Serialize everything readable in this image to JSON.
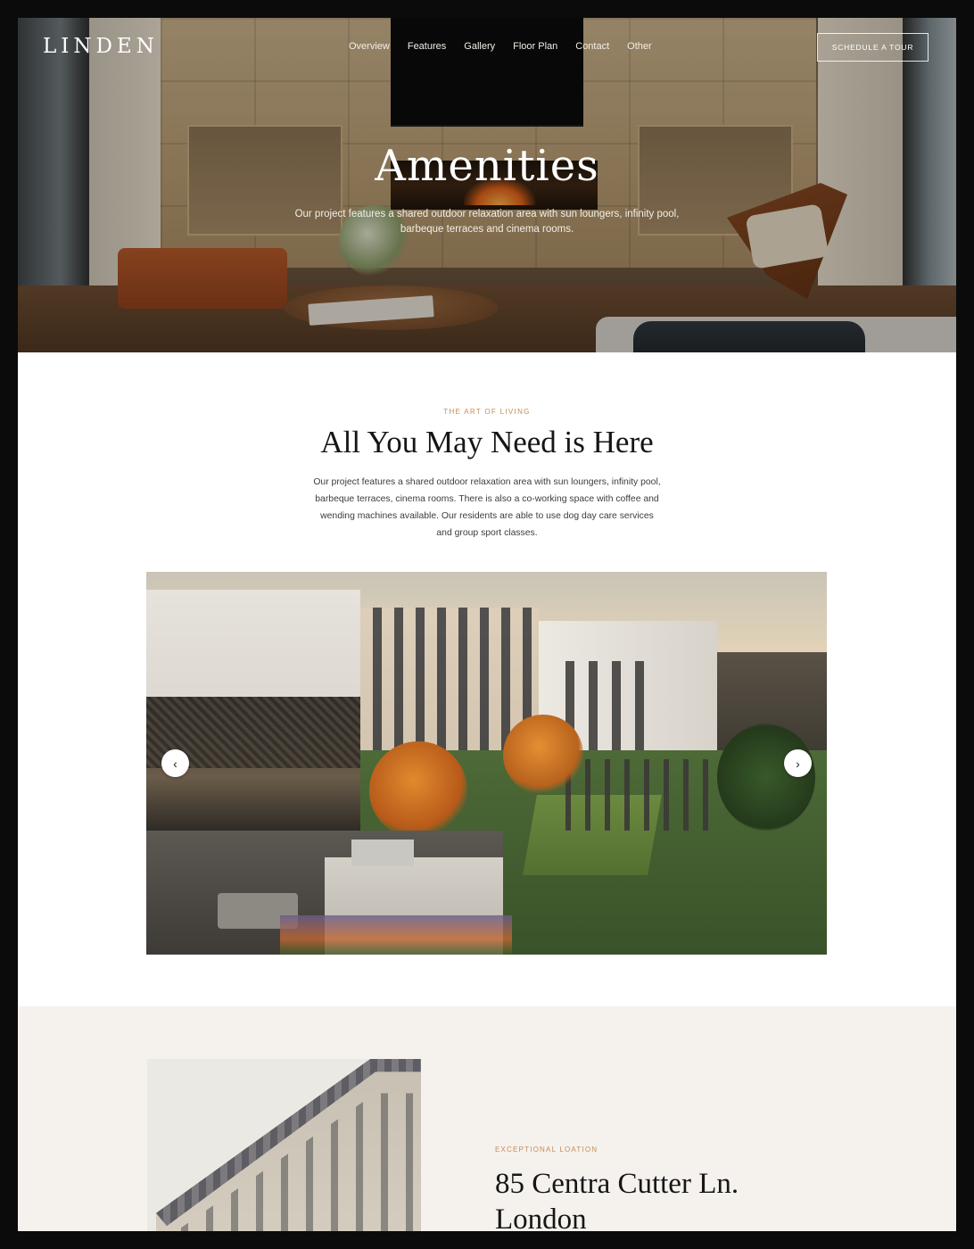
{
  "brand": {
    "logo": "LINDEN"
  },
  "nav": {
    "items": [
      {
        "label": "Overview"
      },
      {
        "label": "Features"
      },
      {
        "label": "Gallery"
      },
      {
        "label": "Floor Plan"
      },
      {
        "label": "Contact"
      },
      {
        "label": "Other"
      }
    ],
    "cta_label": "SCHEDULE A TOUR"
  },
  "hero": {
    "title": "Amenities",
    "subtitle": "Our project features a shared outdoor relaxation area with sun loungers, infinity pool, barbeque terraces and cinema rooms."
  },
  "intro": {
    "eyebrow": "THE ART OF LIVING",
    "title": "All You May Need is Here",
    "body": "Our project features a shared outdoor relaxation area with sun loungers, infinity pool, barbeque terraces, cinema rooms. There is also a co-working space with coffee and wending machines available. Our residents are able to use dog day care services and group sport classes."
  },
  "gallery": {
    "prev_icon": "chevron-left-icon",
    "next_icon": "chevron-right-icon",
    "prev_glyph": "‹",
    "next_glyph": "›"
  },
  "location": {
    "eyebrow": "EXCEPTIONAL LOATION",
    "address_line1": "85 Centra Cutter Ln.",
    "address_line2": "London"
  },
  "colors": {
    "accent": "#c68b56",
    "heading": "#161616",
    "location_bg": "#f5f2ee"
  }
}
